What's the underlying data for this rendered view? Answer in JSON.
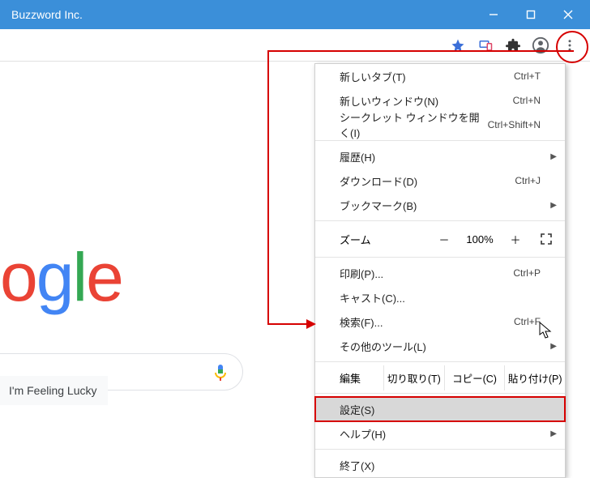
{
  "titlebar": {
    "title": "Buzzword Inc."
  },
  "toolbar": {
    "icons": {
      "star": "star-icon",
      "tablet": "devices-icon",
      "puzzle": "extensions-icon",
      "profile": "profile-icon",
      "kebab": "more-icon"
    }
  },
  "page": {
    "logo_fragment": {
      "c1": "o",
      "c2": "g",
      "c3": "l",
      "c4": "e"
    },
    "lucky_label": "I'm Feeling Lucky"
  },
  "menu": {
    "new_tab": {
      "label": "新しいタブ(T)",
      "shortcut": "Ctrl+T"
    },
    "new_window": {
      "label": "新しいウィンドウ(N)",
      "shortcut": "Ctrl+N"
    },
    "incognito": {
      "label": "シークレット ウィンドウを開く(I)",
      "shortcut": "Ctrl+Shift+N"
    },
    "history": {
      "label": "履歴(H)"
    },
    "downloads": {
      "label": "ダウンロード(D)",
      "shortcut": "Ctrl+J"
    },
    "bookmarks": {
      "label": "ブックマーク(B)"
    },
    "zoom": {
      "label": "ズーム",
      "minus": "－",
      "value": "100%",
      "plus": "＋"
    },
    "print": {
      "label": "印刷(P)...",
      "shortcut": "Ctrl+P"
    },
    "cast": {
      "label": "キャスト(C)..."
    },
    "find": {
      "label": "検索(F)...",
      "shortcut": "Ctrl+F"
    },
    "more_tools": {
      "label": "その他のツール(L)"
    },
    "edit": {
      "label": "編集",
      "cut": "切り取り(T)",
      "copy": "コピー(C)",
      "paste": "貼り付け(P)"
    },
    "settings": {
      "label": "設定(S)"
    },
    "help": {
      "label": "ヘルプ(H)"
    },
    "exit": {
      "label": "終了(X)"
    }
  }
}
